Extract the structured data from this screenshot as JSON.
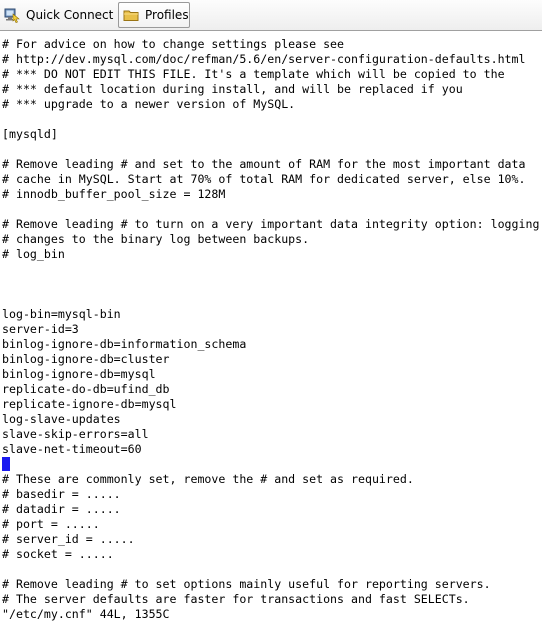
{
  "toolbar": {
    "quick_connect_label": "Quick Connect",
    "profiles_label": "Profiles",
    "icons": [
      "quick-connect-icon",
      "folder-icon"
    ]
  },
  "terminal": {
    "lines": [
      "# For advice on how to change settings please see",
      "# http://dev.mysql.com/doc/refman/5.6/en/server-configuration-defaults.html",
      "# *** DO NOT EDIT THIS FILE. It's a template which will be copied to the",
      "# *** default location during install, and will be replaced if you",
      "# *** upgrade to a newer version of MySQL.",
      "",
      "[mysqld]",
      "",
      "# Remove leading # and set to the amount of RAM for the most important data",
      "# cache in MySQL. Start at 70% of total RAM for dedicated server, else 10%.",
      "# innodb_buffer_pool_size = 128M",
      "",
      "# Remove leading # to turn on a very important data integrity option: logging",
      "# changes to the binary log between backups.",
      "# log_bin",
      "",
      "",
      "",
      "log-bin=mysql-bin",
      "server-id=3",
      "binlog-ignore-db=information_schema",
      "binlog-ignore-db=cluster",
      "binlog-ignore-db=mysql",
      "replicate-do-db=ufind_db",
      "replicate-ignore-db=mysql",
      "log-slave-updates",
      "slave-skip-errors=all",
      "slave-net-timeout=60",
      "",
      "# These are commonly set, remove the # and set as required.",
      "# basedir = .....",
      "# datadir = .....",
      "# port = .....",
      "# server_id = .....",
      "# socket = .....",
      "",
      "# Remove leading # to set options mainly useful for reporting servers.",
      "# The server defaults are faster for transactions and fast SELECTs.",
      "\"/etc/my.cnf\" 44L, 1355C"
    ],
    "cursor_line_index": 28,
    "text_color": "#000000",
    "background_color": "#ffffff",
    "cursor_color": "#1a1af0"
  }
}
